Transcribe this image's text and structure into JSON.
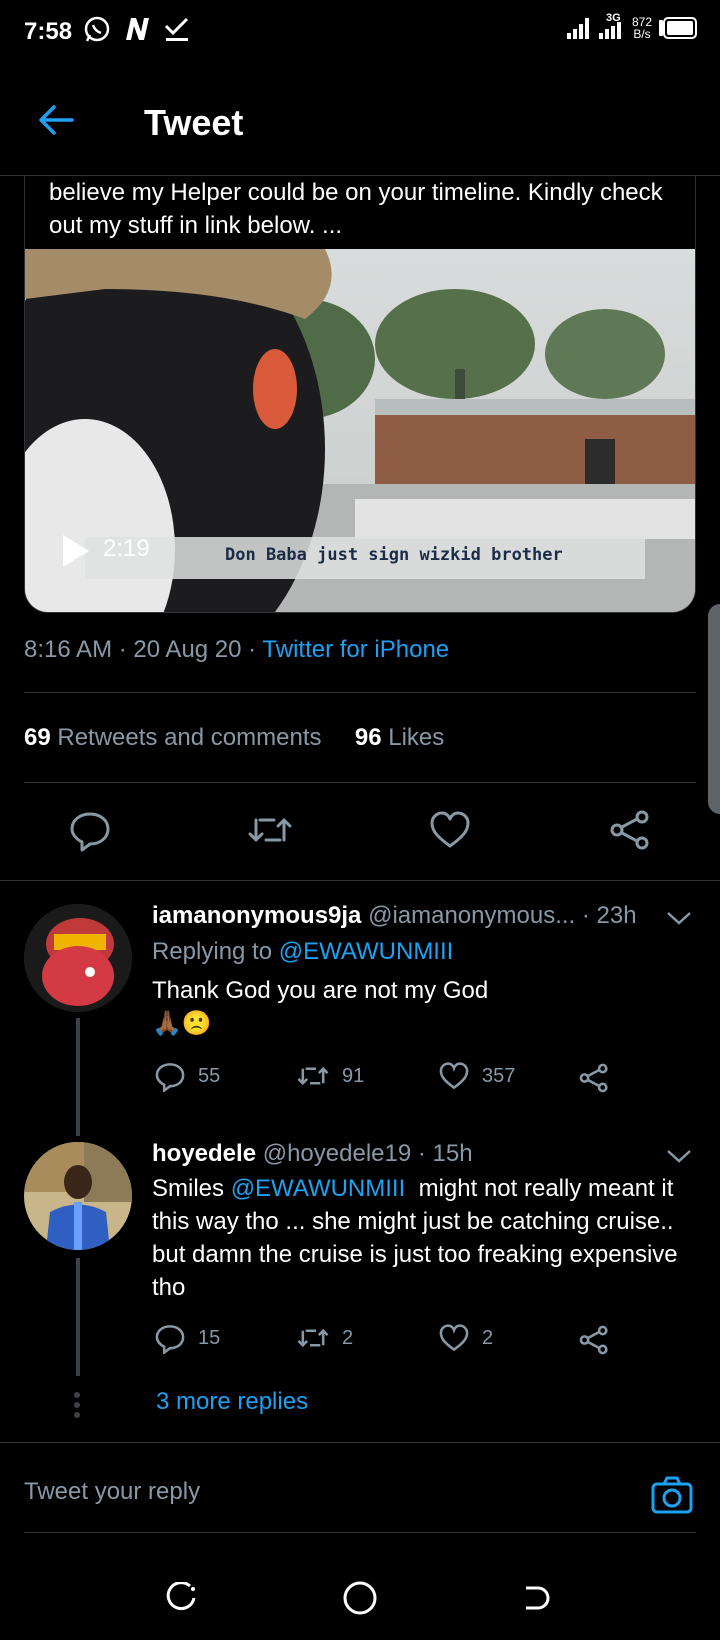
{
  "status_bar": {
    "time": "7:58",
    "net_speed_value": "872",
    "net_speed_unit": "B/s",
    "network": "3G",
    "icons": [
      "whatsapp-icon",
      "n-icon",
      "check-download-icon",
      "signal-icon",
      "signal-3g-icon",
      "battery-icon"
    ]
  },
  "header": {
    "title": "Tweet"
  },
  "tweet": {
    "text": "believe my Helper could be on your timeline. Kindly check out my stuff in link below. ...",
    "video": {
      "duration": "2:19",
      "caption": "Don Baba just sign wizkid brother"
    },
    "time": "8:16 AM",
    "date": "20 Aug 20",
    "source": "Twitter for iPhone",
    "retweets_count": "69",
    "retweets_label": "Retweets and comments",
    "likes_count": "96",
    "likes_label": "Likes"
  },
  "replies": [
    {
      "name": "iamanonymous9ja",
      "handle": "@iamanonymous...",
      "age": "· 23h",
      "replying_prefix": "Replying to",
      "replying_to": "@EWAWUNMIII",
      "text": "Thank God you are not my God",
      "emoji": "🙏🏾🙁",
      "comments": "55",
      "retweets": "91",
      "likes": "357"
    },
    {
      "name": "hoyedele",
      "handle": "@hoyedele19",
      "age": "· 15h",
      "text_prefix": "Smiles",
      "mention": "@EWAWUNMIII",
      "text": "might not really meant it this way tho ... she might just be catching cruise.. but damn the cruise is just too freaking expensive tho",
      "comments": "15",
      "retweets": "2",
      "likes": "2"
    }
  ],
  "more_replies": "3 more replies",
  "compose": {
    "placeholder": "Tweet your reply"
  },
  "colors": {
    "accent": "#1da1f2",
    "background": "#000000",
    "muted": "#8899a6",
    "divider": "#2f3336"
  }
}
